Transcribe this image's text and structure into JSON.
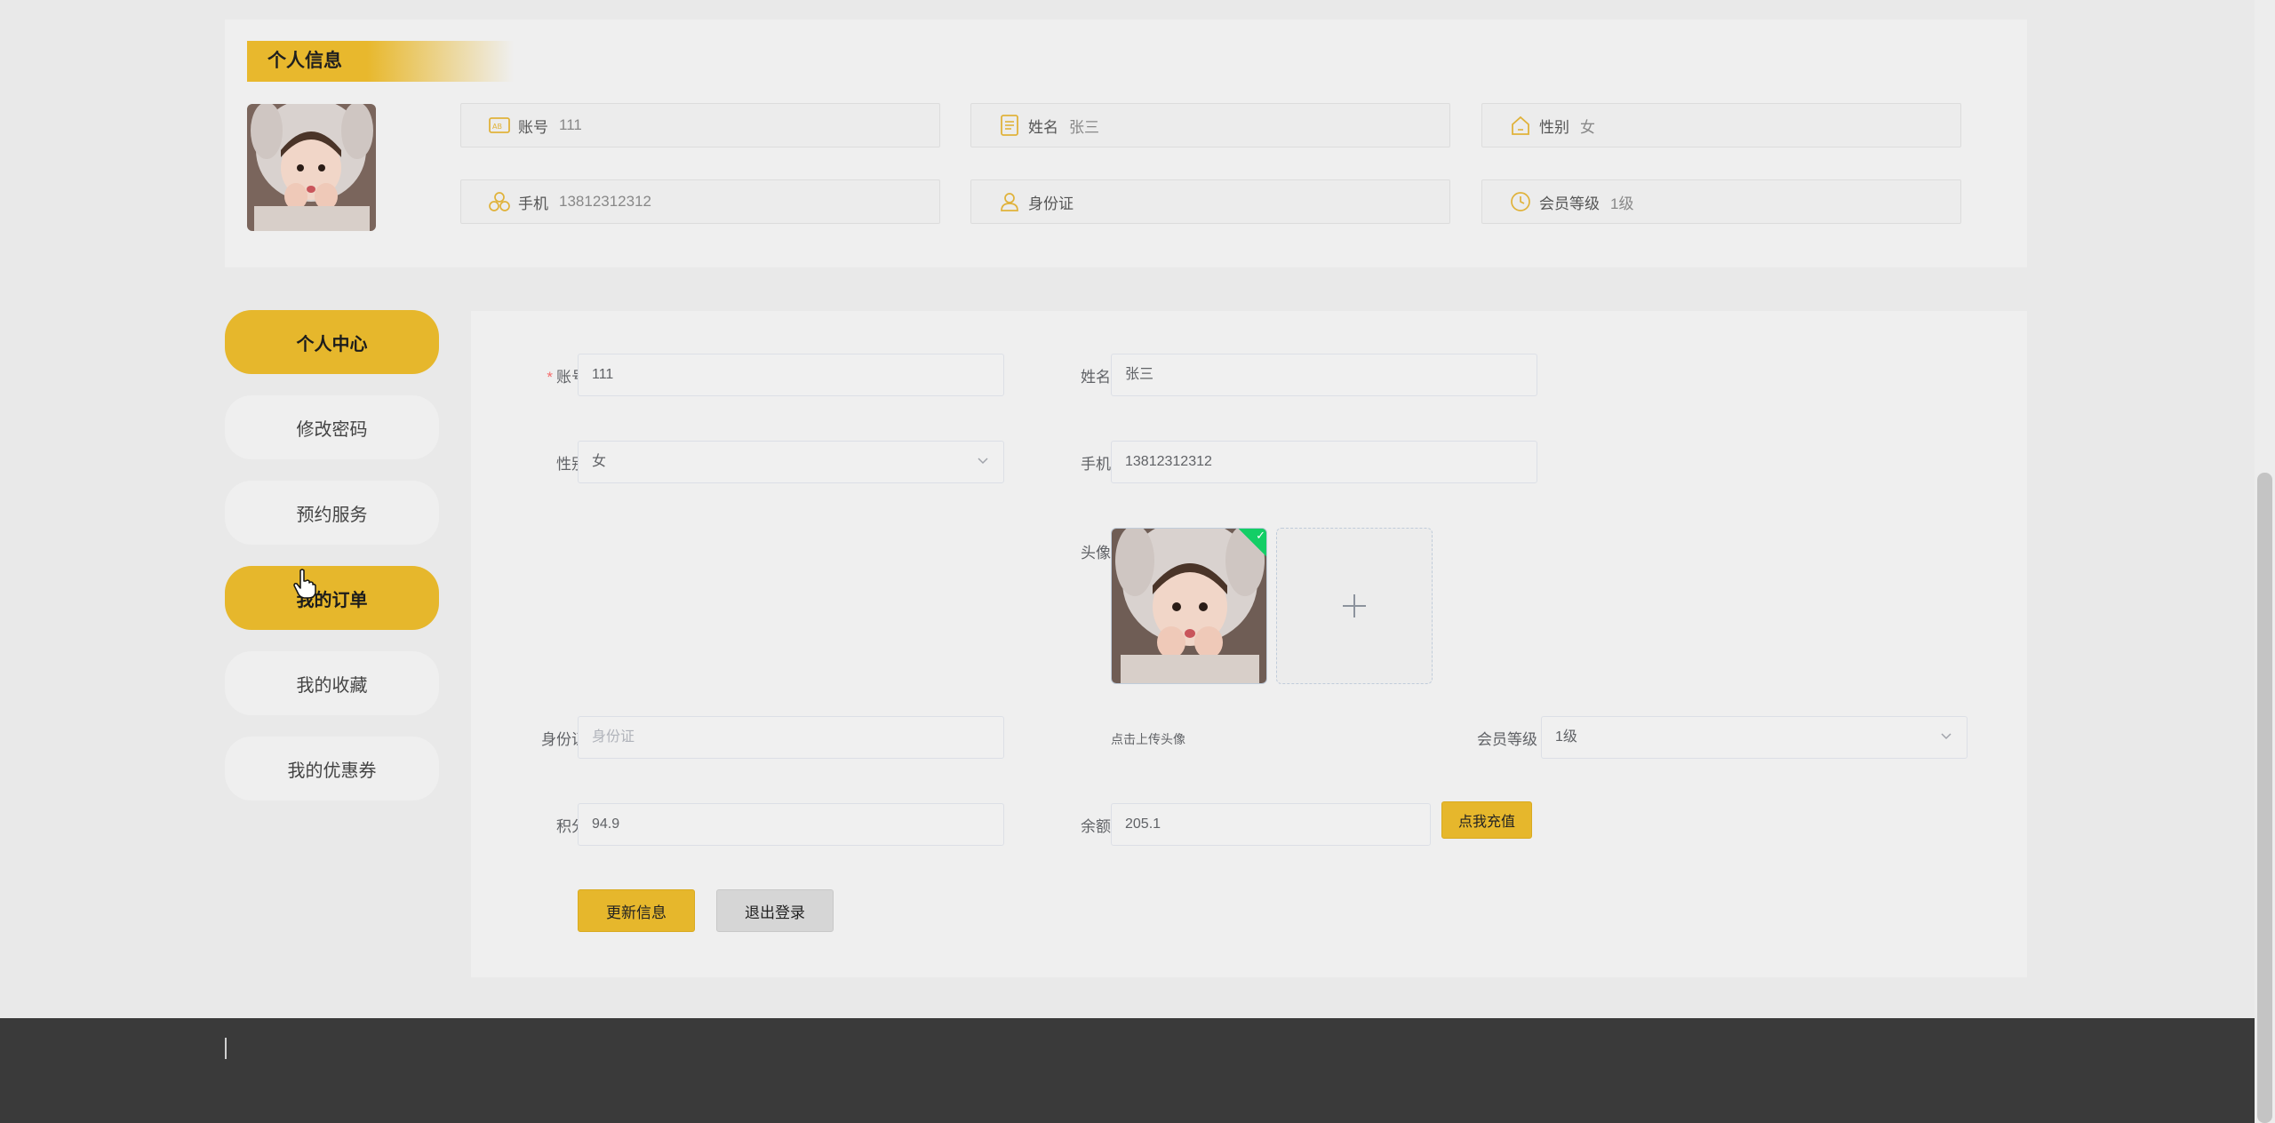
{
  "info": {
    "title": "个人信息",
    "fields": [
      {
        "label": "账号",
        "value": "111",
        "icon": "id-card-icon"
      },
      {
        "label": "姓名",
        "value": "张三",
        "icon": "document-icon"
      },
      {
        "label": "性别",
        "value": "女",
        "icon": "home-icon"
      },
      {
        "label": "手机",
        "value": "13812312312",
        "icon": "hexagon-cluster-icon"
      },
      {
        "label": "身份证",
        "value": "",
        "icon": "user-icon"
      },
      {
        "label": "会员等级",
        "value": "1级",
        "icon": "clock-icon"
      }
    ]
  },
  "sidebar": {
    "items": [
      {
        "label": "个人中心",
        "active": true
      },
      {
        "label": "修改密码",
        "active": false
      },
      {
        "label": "预约服务",
        "active": false
      },
      {
        "label": "我的订单",
        "active": true
      },
      {
        "label": "我的收藏",
        "active": false
      },
      {
        "label": "我的优惠券",
        "active": false
      }
    ]
  },
  "form": {
    "account": {
      "label": "账号",
      "required_mark": "*",
      "value": "111"
    },
    "name": {
      "label": "姓名",
      "value": "张三"
    },
    "gender": {
      "label": "性别",
      "value": "女"
    },
    "phone": {
      "label": "手机",
      "value": "13812312312"
    },
    "avatar": {
      "label": "头像",
      "hint": "点击上传头像"
    },
    "idcard": {
      "label": "身份证",
      "placeholder": "身份证"
    },
    "level": {
      "label": "会员等级",
      "value": "1级"
    },
    "points": {
      "label": "积分",
      "value": "94.9"
    },
    "balance": {
      "label": "余额",
      "value": "205.1",
      "recharge_label": "点我充值"
    },
    "update_label": "更新信息",
    "logout_label": "退出登录"
  },
  "colors": {
    "accent": "#e6b72c",
    "footer": "#3a3a3a",
    "panel": "#efefef"
  }
}
